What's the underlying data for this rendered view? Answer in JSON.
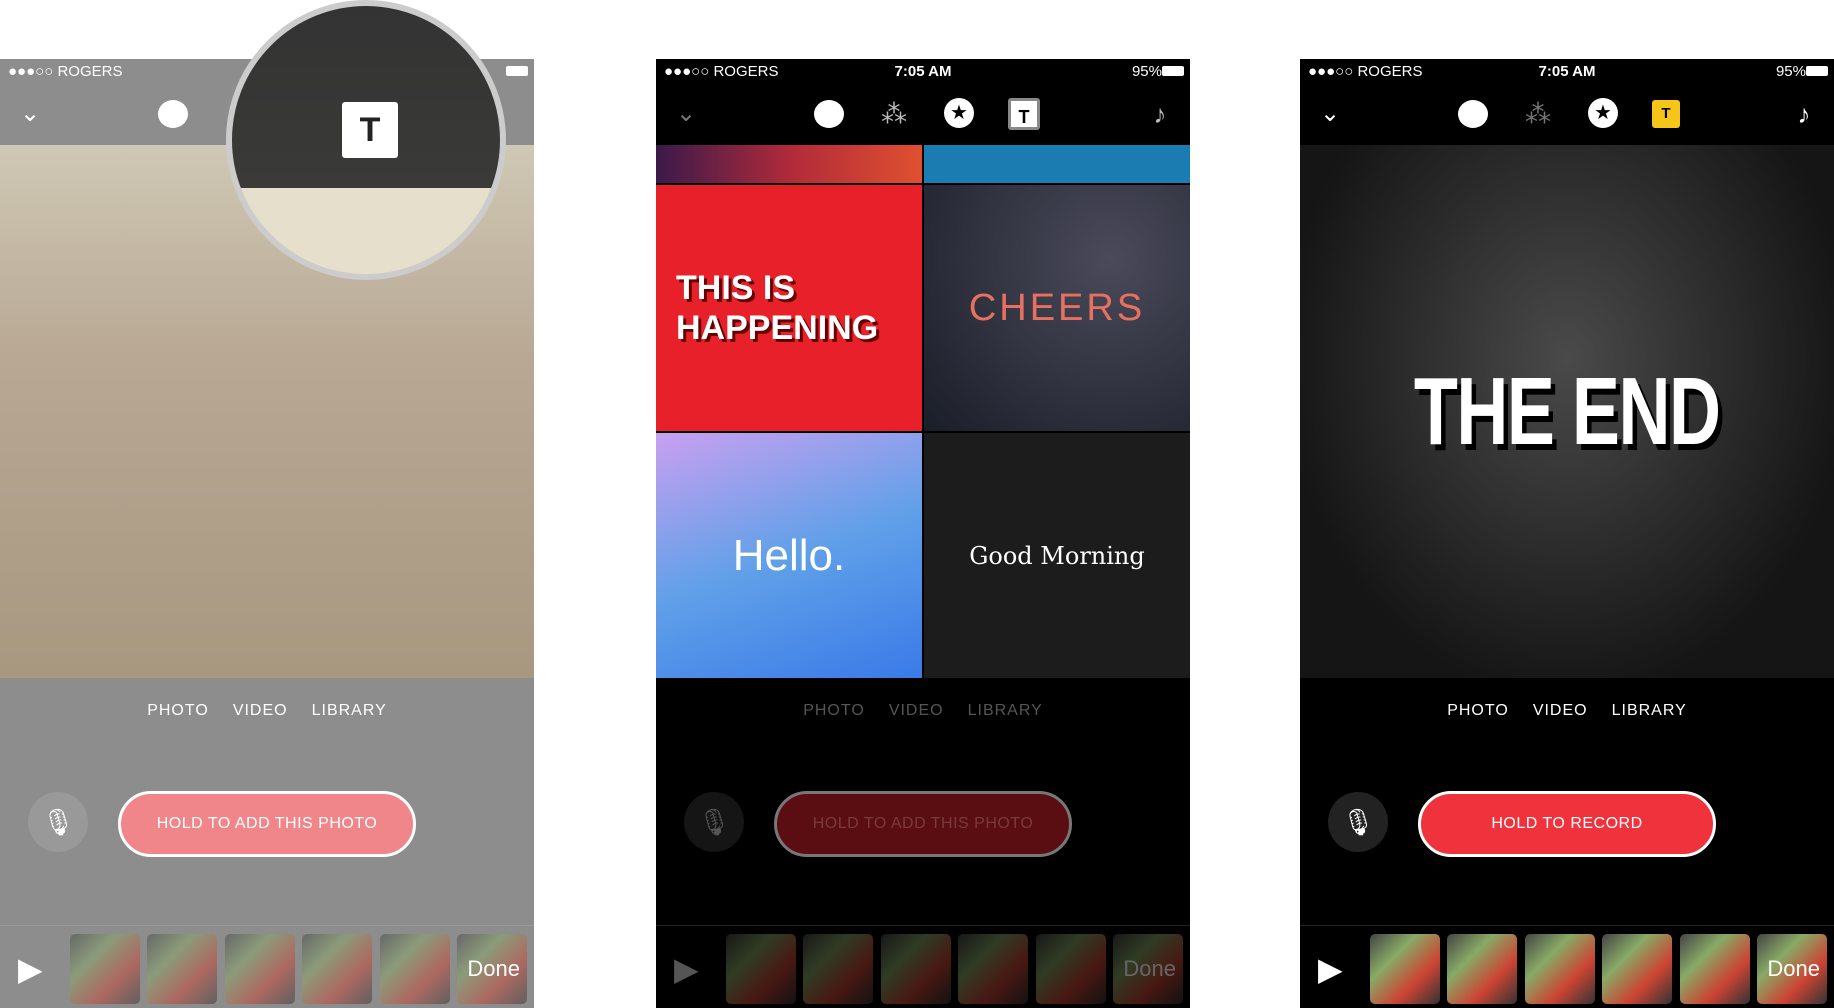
{
  "status": {
    "carrier": "●●●○○ ROGERS",
    "time": "7:05 AM",
    "battery": "95%"
  },
  "tabs": [
    "PHOTO",
    "VIDEO",
    "LIBRARY"
  ],
  "phones": [
    {
      "record_label": "HOLD TO ADD THIS PHOTO",
      "done": "Done",
      "active_tool": "title-cards"
    },
    {
      "record_label": "HOLD TO ADD THIS PHOTO",
      "done": "Done",
      "cards": [
        "THIS IS HAPPENING",
        "CHEERS",
        "Hello.",
        "Good Morning"
      ]
    },
    {
      "record_label": "HOLD TO RECORD",
      "done": "Done",
      "title_card": "THE END"
    }
  ],
  "icons": {
    "t": "T"
  },
  "colors": {
    "accent_red": "#f0323c",
    "title_yellow": "#f5c518"
  }
}
